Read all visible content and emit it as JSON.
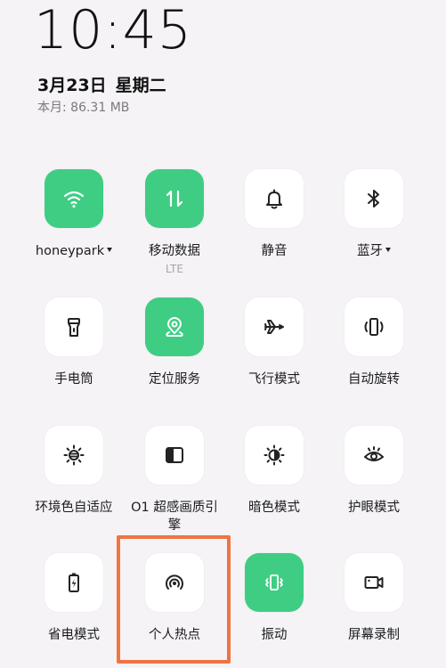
{
  "status": {
    "time": "10:45",
    "date": "3月23日",
    "weekday": "星期二",
    "usage": "本月: 86.31 MB"
  },
  "colors": {
    "active_tile": "#3fcd84",
    "inactive_tile": "#ffffff",
    "highlight_border": "#f07442",
    "background": "#f5f3f6"
  },
  "tiles": [
    {
      "label": "honeypark",
      "icon": "wifi-icon",
      "active": true,
      "dropdown": true
    },
    {
      "label": "移动数据",
      "sub": "LTE",
      "icon": "mobile-data-icon",
      "active": true
    },
    {
      "label": "静音",
      "icon": "bell-icon",
      "active": false
    },
    {
      "label": "蓝牙",
      "icon": "bluetooth-icon",
      "active": false,
      "dropdown": true
    },
    {
      "label": "手电筒",
      "icon": "flashlight-icon",
      "active": false
    },
    {
      "label": "定位服务",
      "icon": "location-icon",
      "active": true
    },
    {
      "label": "飞行模式",
      "icon": "airplane-icon",
      "active": false
    },
    {
      "label": "自动旋转",
      "icon": "auto-rotate-icon",
      "active": false
    },
    {
      "label": "环境色自适应",
      "icon": "ambient-color-icon",
      "active": false
    },
    {
      "label": "O1 超感画质引擎",
      "icon": "display-engine-icon",
      "active": false
    },
    {
      "label": "暗色模式",
      "icon": "dark-mode-icon",
      "active": false
    },
    {
      "label": "护眼模式",
      "icon": "eye-care-icon",
      "active": false
    },
    {
      "label": "省电模式",
      "icon": "battery-saver-icon",
      "active": false
    },
    {
      "label": "个人热点",
      "icon": "hotspot-icon",
      "active": false,
      "highlighted": true
    },
    {
      "label": "振动",
      "icon": "vibrate-icon",
      "active": true
    },
    {
      "label": "屏幕录制",
      "icon": "screen-record-icon",
      "active": false
    }
  ]
}
